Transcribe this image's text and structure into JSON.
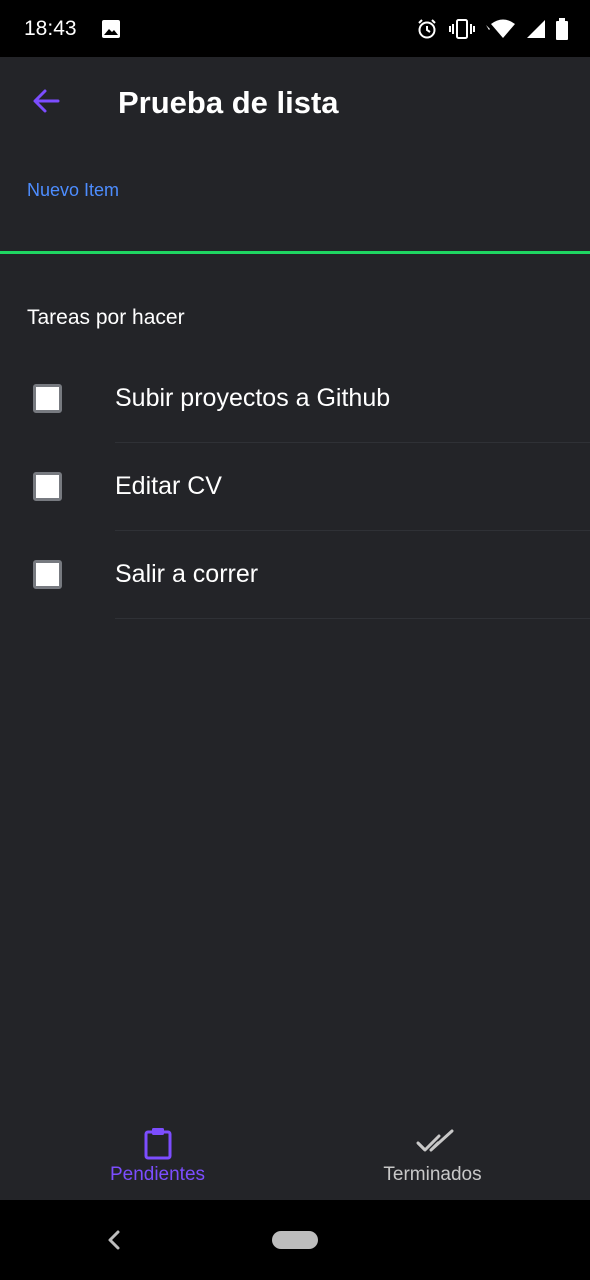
{
  "status_bar": {
    "time": "18:43",
    "icons": [
      "photo-icon",
      "alarm-icon",
      "vibrate-icon",
      "wifi-icon",
      "signal-icon",
      "battery-icon"
    ]
  },
  "app_bar": {
    "title": "Prueba de lista",
    "back_icon": "arrow-back-icon",
    "accent_color": "#7c4dff"
  },
  "new_item_field": {
    "label": "Nuevo Item",
    "value": "",
    "label_color": "#4d8dff",
    "underline_color": "#1fd662"
  },
  "tasks_section": {
    "title": "Tareas por hacer",
    "items": [
      {
        "label": "Subir proyectos a Github",
        "checked": false
      },
      {
        "label": "Editar CV",
        "checked": false
      },
      {
        "label": "Salir a correr",
        "checked": false
      }
    ]
  },
  "bottom_nav": {
    "items": [
      {
        "label": "Pendientes",
        "icon": "clipboard-icon",
        "active": true
      },
      {
        "label": "Terminados",
        "icon": "done-all-icon",
        "active": false
      }
    ],
    "active_color": "#7c4dff"
  },
  "system_nav": {
    "back_icon": "chevron-left-icon",
    "home_icon": "home-pill-icon"
  }
}
